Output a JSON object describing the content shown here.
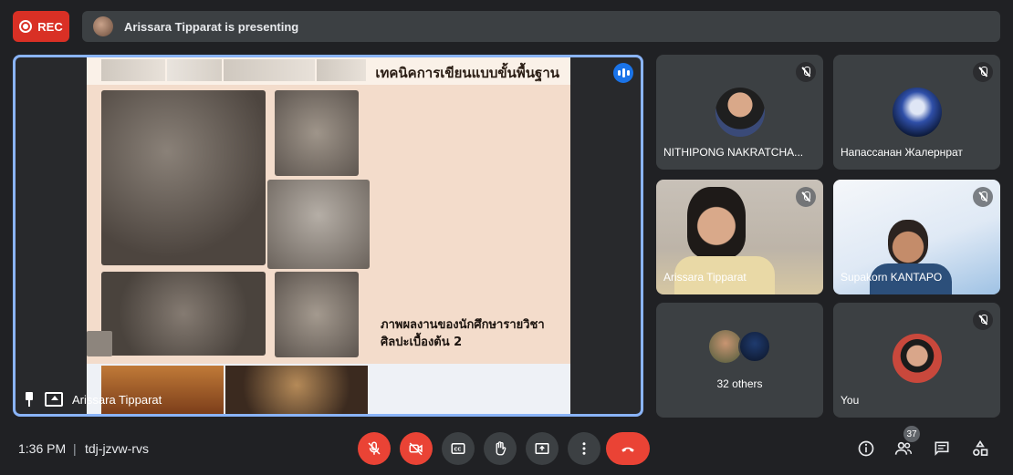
{
  "top_bar": {
    "rec_label": "REC",
    "presenting_text": "Arissara Tipparat is presenting"
  },
  "main": {
    "slide_title": "เทคนิคการเขียนแบบขั้นพื้นฐาน",
    "slide_caption_line1": "ภาพผลงานของนักศึกษารายวิชา",
    "slide_caption_line2": "ศิลปะเบื้องต้น 2",
    "presenter_name": "Arissara Tipparat"
  },
  "tiles": [
    {
      "name": "NITHIPONG NAKRATCHA...",
      "muted": true
    },
    {
      "name": "Напассанан Жалернрат",
      "muted": true
    },
    {
      "name": "Arissara Tipparat",
      "muted": true
    },
    {
      "name": "Supakorn KANTAPO",
      "muted": true
    },
    {
      "name": "32 others",
      "muted": false
    },
    {
      "name": "You",
      "muted": true
    }
  ],
  "bottom_bar": {
    "time": "1:36 PM",
    "divider": "|",
    "meeting_code": "tdj-jzvw-rvs",
    "participants_count": "37"
  },
  "colors": {
    "accent": "#8ab4f8",
    "danger": "#ea4335",
    "background": "#202124",
    "tile": "#3c4043"
  }
}
